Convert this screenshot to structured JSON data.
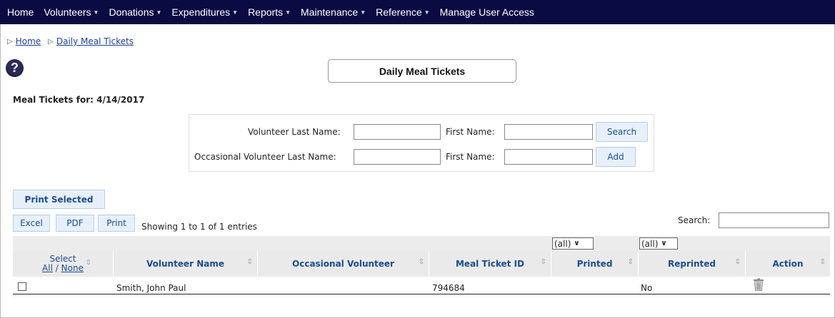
{
  "nav": {
    "items": [
      {
        "label": "Home",
        "dropdown": false
      },
      {
        "label": "Volunteers",
        "dropdown": true
      },
      {
        "label": "Donations",
        "dropdown": true
      },
      {
        "label": "Expenditures",
        "dropdown": true
      },
      {
        "label": "Reports",
        "dropdown": true
      },
      {
        "label": "Maintenance",
        "dropdown": true
      },
      {
        "label": "Reference",
        "dropdown": true
      },
      {
        "label": "Manage User Access",
        "dropdown": false
      }
    ]
  },
  "breadcrumb": {
    "home": "Home",
    "current": "Daily Meal Tickets"
  },
  "page": {
    "title": "Daily Meal Tickets",
    "help_icon": "?",
    "tickets_for": "Meal Tickets for: 4/14/2017"
  },
  "search_form": {
    "volunteer_last_label": "Volunteer Last Name:",
    "first_name_label": "First Name:",
    "occasional_last_label": "Occasional Volunteer Last Name:",
    "first_name_label_2": "First Name:",
    "search_button": "Search",
    "add_button": "Add"
  },
  "toolbar": {
    "print_selected": "Print Selected",
    "excel": "Excel",
    "pdf": "PDF",
    "print": "Print",
    "showing": "Showing 1 to 1 of 1 entries",
    "search_label": "Search:"
  },
  "filters": {
    "printed": "(all)",
    "reprinted": "(all)"
  },
  "table": {
    "select_header": "Select",
    "select_all": "All",
    "select_sep": "/",
    "select_none": "None",
    "headers": {
      "volunteer_name": "Volunteer Name",
      "occasional_volunteer": "Occasional Volunteer",
      "meal_ticket_id": "Meal Ticket ID",
      "printed": "Printed",
      "reprinted": "Reprinted",
      "action": "Action"
    },
    "rows": [
      {
        "volunteer_name": "Smith, John Paul",
        "occasional_volunteer": "",
        "meal_ticket_id": "794684",
        "printed": "",
        "reprinted": "No"
      }
    ]
  },
  "colors": {
    "nav_bg": "#0b0b44",
    "link": "#1a3e9f",
    "button_bg": "#e7f0fa",
    "header_text": "#1a4d8f"
  }
}
